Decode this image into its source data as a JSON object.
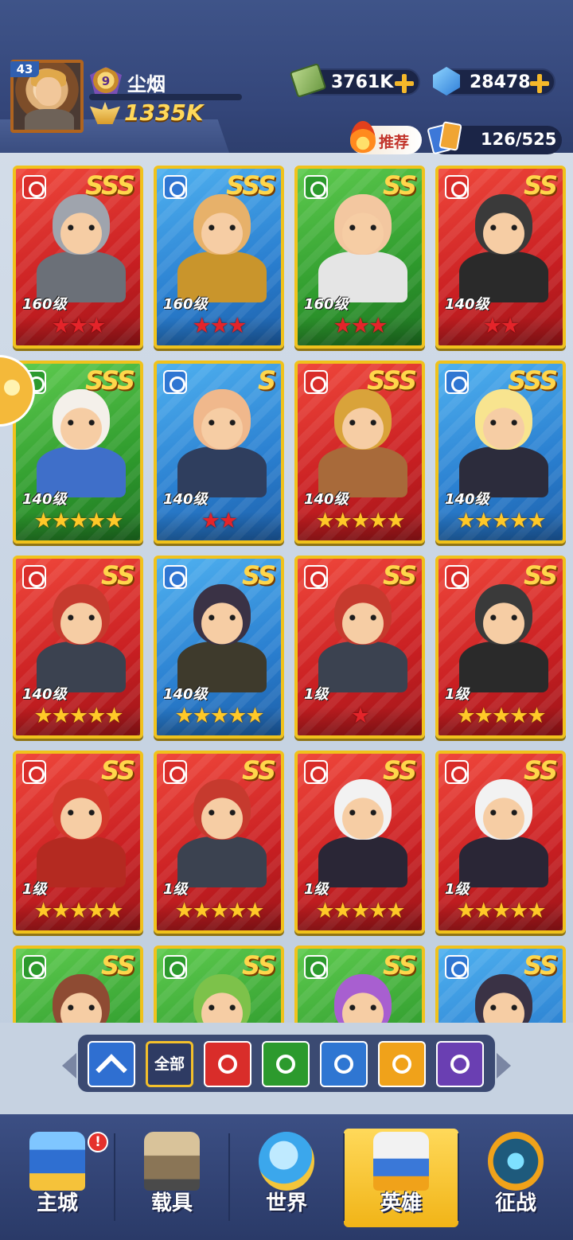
{
  "player": {
    "level": "43",
    "vip": "9",
    "name": "尘烟",
    "power": "1335K"
  },
  "resources": {
    "cash": "3761K",
    "gems": "28478"
  },
  "recommend_label": "推荐",
  "collection_count": "126/525",
  "heroes": [
    {
      "rank": "SSS",
      "level": "160级",
      "faction": "red",
      "stars": 3,
      "star_color": "red"
    },
    {
      "rank": "SSS",
      "level": "160级",
      "faction": "blue",
      "stars": 3,
      "star_color": "red"
    },
    {
      "rank": "SS",
      "level": "160级",
      "faction": "green",
      "stars": 3,
      "star_color": "red"
    },
    {
      "rank": "SS",
      "level": "140级",
      "faction": "red",
      "stars": 2,
      "star_color": "red"
    },
    {
      "rank": "SSS",
      "level": "140级",
      "faction": "green",
      "stars": 5,
      "star_color": "gold"
    },
    {
      "rank": "S",
      "level": "140级",
      "faction": "blue",
      "stars": 2,
      "star_color": "red"
    },
    {
      "rank": "SSS",
      "level": "140级",
      "faction": "red",
      "stars": 5,
      "star_color": "gold"
    },
    {
      "rank": "SSS",
      "level": "140级",
      "faction": "blue",
      "stars": 5,
      "star_color": "gold"
    },
    {
      "rank": "SS",
      "level": "140级",
      "faction": "red",
      "stars": 5,
      "star_color": "gold"
    },
    {
      "rank": "SS",
      "level": "140级",
      "faction": "blue",
      "stars": 5,
      "star_color": "gold"
    },
    {
      "rank": "SS",
      "level": "1级",
      "faction": "red",
      "stars": 1,
      "star_color": "red"
    },
    {
      "rank": "SS",
      "level": "1级",
      "faction": "red",
      "stars": 5,
      "star_color": "gold"
    },
    {
      "rank": "SS",
      "level": "1级",
      "faction": "red",
      "stars": 5,
      "star_color": "gold"
    },
    {
      "rank": "SS",
      "level": "1级",
      "faction": "red",
      "stars": 5,
      "star_color": "gold"
    },
    {
      "rank": "SS",
      "level": "1级",
      "faction": "red",
      "stars": 5,
      "star_color": "gold"
    },
    {
      "rank": "SS",
      "level": "1级",
      "faction": "red",
      "stars": 5,
      "star_color": "gold"
    },
    {
      "rank": "SS",
      "level": "",
      "faction": "green",
      "stars": 0,
      "star_color": "gold"
    },
    {
      "rank": "SS",
      "level": "",
      "faction": "green",
      "stars": 0,
      "star_color": "gold"
    },
    {
      "rank": "SS",
      "level": "",
      "faction": "green",
      "stars": 0,
      "star_color": "gold"
    },
    {
      "rank": "SS",
      "level": "",
      "faction": "blue",
      "stars": 0,
      "star_color": "gold"
    }
  ],
  "filters": [
    {
      "name": "filter-rank-up",
      "icon": "chevron-up-icon",
      "color": "#2f6fd1",
      "label": ""
    },
    {
      "name": "filter-all",
      "icon": "",
      "color": "#2e3b63",
      "label": "全部"
    },
    {
      "name": "filter-red-faction",
      "icon": "red-faction-icon",
      "color": "#d92d2a",
      "label": ""
    },
    {
      "name": "filter-green-faction",
      "icon": "green-faction-icon",
      "color": "#2c9a2d",
      "label": ""
    },
    {
      "name": "filter-blue-faction",
      "icon": "blue-faction-icon",
      "color": "#2f76d2",
      "label": ""
    },
    {
      "name": "filter-gold-faction",
      "icon": "gold-faction-icon",
      "color": "#f0a21a",
      "label": ""
    },
    {
      "name": "filter-purple-faction",
      "icon": "purple-faction-icon",
      "color": "#6a3fb2",
      "label": ""
    }
  ],
  "nav": [
    {
      "name": "nav-main-city",
      "label": "主城",
      "icon": "castle-icon",
      "badge": "!",
      "active": false
    },
    {
      "name": "nav-vehicle",
      "label": "载具",
      "icon": "mech-icon",
      "badge": "",
      "active": false
    },
    {
      "name": "nav-world",
      "label": "世界",
      "icon": "globe-icon",
      "badge": "",
      "active": false
    },
    {
      "name": "nav-heroes",
      "label": "英雄",
      "icon": "helmet-icon",
      "badge": "",
      "active": true
    },
    {
      "name": "nav-campaign",
      "label": "征战",
      "icon": "radar-icon",
      "badge": "",
      "active": false
    }
  ],
  "colors": {
    "card_red": "#c91f22",
    "card_blue": "#2a7fd0",
    "card_green": "#2f9b2d",
    "card_border": "#f0c21c",
    "rank_gold": "#ffd64b",
    "header_bg": "#34467a"
  }
}
